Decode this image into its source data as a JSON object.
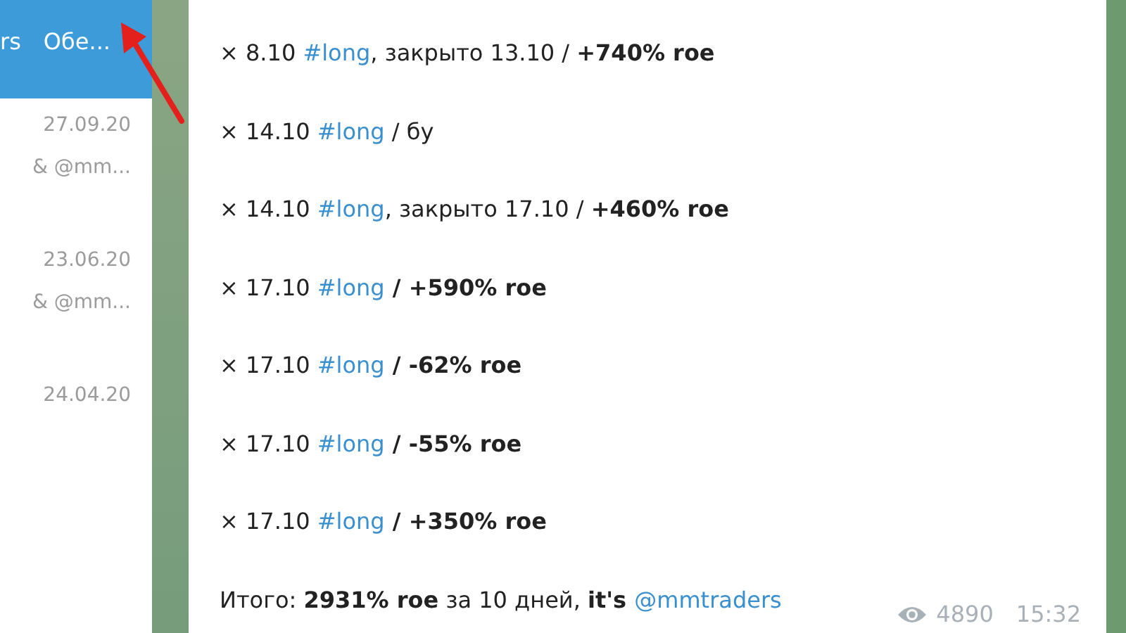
{
  "header": {
    "labels": [
      "rs",
      "Обе..."
    ]
  },
  "chat_list": [
    {
      "date": "27.09.20",
      "preview": "& @mm..."
    },
    {
      "date": "23.06.20",
      "preview": "& @mm..."
    },
    {
      "date": "24.04.20"
    }
  ],
  "message": {
    "lines": [
      [
        {
          "kind": "plain",
          "text": "× 8.10  "
        },
        {
          "kind": "hashtag",
          "text": "#long"
        },
        {
          "kind": "plain",
          "text": ",  закрыто 13.10 / "
        },
        {
          "kind": "bold",
          "text": "+740% roe"
        }
      ],
      [
        {
          "kind": "plain",
          "text": "× 14.10 "
        },
        {
          "kind": "hashtag",
          "text": "#long"
        },
        {
          "kind": "plain",
          "text": " / бу"
        }
      ],
      [
        {
          "kind": "plain",
          "text": "× 14.10 "
        },
        {
          "kind": "hashtag",
          "text": "#long"
        },
        {
          "kind": "plain",
          "text": ", закрыто 17.10 / "
        },
        {
          "kind": "bold",
          "text": "+460% roe"
        }
      ],
      [
        {
          "kind": "plain",
          "text": "× 17.10  "
        },
        {
          "kind": "hashtag",
          "text": "#long"
        },
        {
          "kind": "bold",
          "text": " / +590% roe"
        }
      ],
      [
        {
          "kind": "plain",
          "text": "× 17.10  "
        },
        {
          "kind": "hashtag",
          "text": "#long"
        },
        {
          "kind": "bold",
          "text": " / -62% roe"
        }
      ],
      [
        {
          "kind": "plain",
          "text": "× 17.10  "
        },
        {
          "kind": "hashtag",
          "text": "#long"
        },
        {
          "kind": "bold",
          "text": " / -55% roe"
        }
      ],
      [
        {
          "kind": "plain",
          "text": "× 17.10 "
        },
        {
          "kind": "hashtag",
          "text": "#long"
        },
        {
          "kind": "bold",
          "text": " / +350% roe"
        }
      ],
      [
        {
          "kind": "plain",
          "text": "Итого: "
        },
        {
          "kind": "bold",
          "text": "2931% roe"
        },
        {
          "kind": "plain",
          "text": " за 10 дней, "
        },
        {
          "kind": "bold",
          "text": "it's "
        },
        {
          "kind": "mention",
          "text": "@mmtraders"
        }
      ]
    ],
    "views": "4890",
    "time": "15:32"
  }
}
